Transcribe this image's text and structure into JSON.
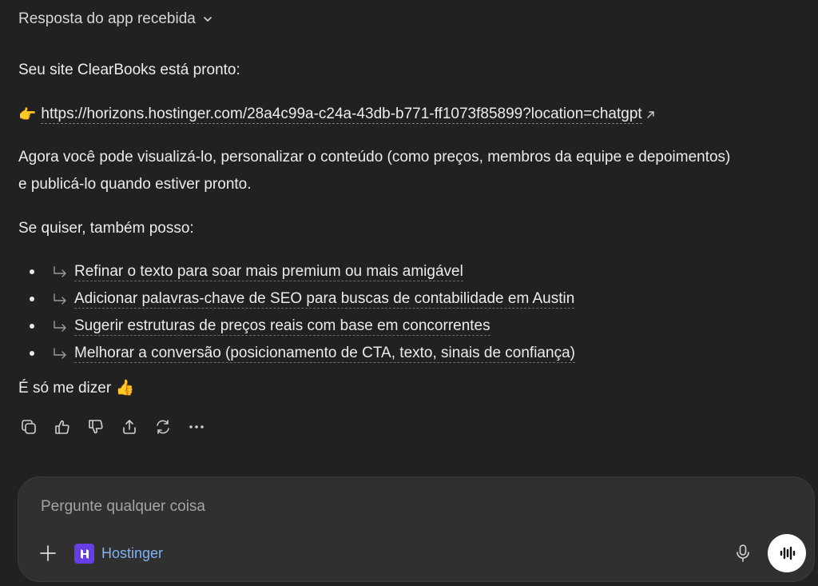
{
  "message": {
    "header": "Resposta do app recebida",
    "ready_text": "Seu site ClearBooks está pronto:",
    "link_emoji": "👉",
    "link_url": "https://horizons.hostinger.com/28a4c99a-c24a-43db-b771-ff1073f85899?location=chatgpt",
    "now_text": "Agora você pode visualizá-lo, personalizar o conteúdo (como preços, membros da equipe e depoimentos) e publicá-lo quando estiver pronto.",
    "also_text": "Se quiser, também posso:",
    "suggestions": [
      "Refinar o texto para soar mais premium ou mais amigável",
      "Adicionar palavras-chave de SEO para buscas de contabilidade em Austin",
      "Sugerir estruturas de preços reais com base em concorrentes",
      "Melhorar a conversão (posicionamento de CTA, texto, sinais de confiança)"
    ],
    "closing_text": "É só me dizer",
    "closing_emoji": "👍"
  },
  "actions": [
    "copy-icon",
    "thumbs-up-icon",
    "thumbs-down-icon",
    "share-icon",
    "regenerate-icon",
    "more-icon"
  ],
  "composer": {
    "placeholder": "Pergunte qualquer coisa",
    "tool_label": "Hostinger",
    "tool_color": "#673de6",
    "tool_label_color": "#7fb3f5"
  }
}
